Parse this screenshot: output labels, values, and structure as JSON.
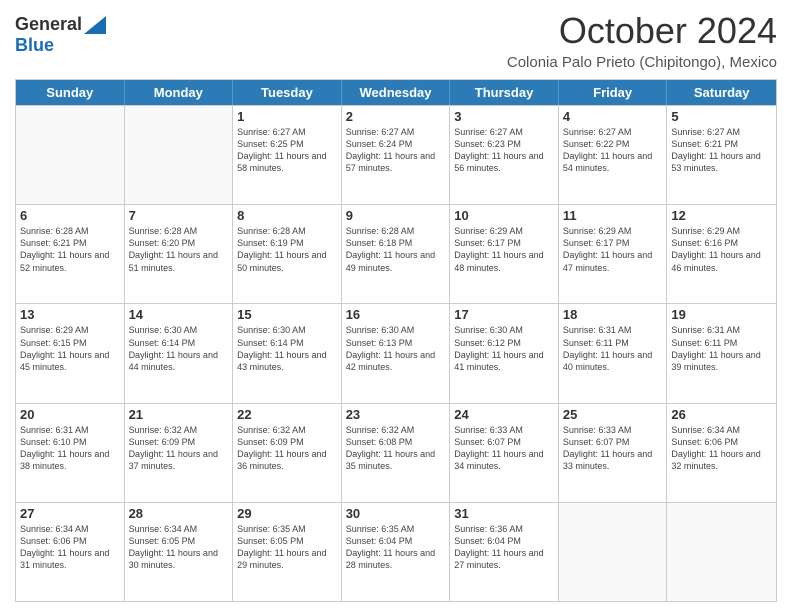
{
  "logo": {
    "general": "General",
    "blue": "Blue"
  },
  "title": {
    "month": "October 2024",
    "location": "Colonia Palo Prieto (Chipitongo), Mexico"
  },
  "header": {
    "days": [
      "Sunday",
      "Monday",
      "Tuesday",
      "Wednesday",
      "Thursday",
      "Friday",
      "Saturday"
    ]
  },
  "weeks": [
    [
      {
        "day": "",
        "empty": true
      },
      {
        "day": "",
        "empty": true
      },
      {
        "day": "1",
        "sunrise": "6:27 AM",
        "sunset": "6:25 PM",
        "daylight": "11 hours and 58 minutes."
      },
      {
        "day": "2",
        "sunrise": "6:27 AM",
        "sunset": "6:24 PM",
        "daylight": "11 hours and 57 minutes."
      },
      {
        "day": "3",
        "sunrise": "6:27 AM",
        "sunset": "6:23 PM",
        "daylight": "11 hours and 56 minutes."
      },
      {
        "day": "4",
        "sunrise": "6:27 AM",
        "sunset": "6:22 PM",
        "daylight": "11 hours and 54 minutes."
      },
      {
        "day": "5",
        "sunrise": "6:27 AM",
        "sunset": "6:21 PM",
        "daylight": "11 hours and 53 minutes."
      }
    ],
    [
      {
        "day": "6",
        "sunrise": "6:28 AM",
        "sunset": "6:21 PM",
        "daylight": "11 hours and 52 minutes."
      },
      {
        "day": "7",
        "sunrise": "6:28 AM",
        "sunset": "6:20 PM",
        "daylight": "11 hours and 51 minutes."
      },
      {
        "day": "8",
        "sunrise": "6:28 AM",
        "sunset": "6:19 PM",
        "daylight": "11 hours and 50 minutes."
      },
      {
        "day": "9",
        "sunrise": "6:28 AM",
        "sunset": "6:18 PM",
        "daylight": "11 hours and 49 minutes."
      },
      {
        "day": "10",
        "sunrise": "6:29 AM",
        "sunset": "6:17 PM",
        "daylight": "11 hours and 48 minutes."
      },
      {
        "day": "11",
        "sunrise": "6:29 AM",
        "sunset": "6:17 PM",
        "daylight": "11 hours and 47 minutes."
      },
      {
        "day": "12",
        "sunrise": "6:29 AM",
        "sunset": "6:16 PM",
        "daylight": "11 hours and 46 minutes."
      }
    ],
    [
      {
        "day": "13",
        "sunrise": "6:29 AM",
        "sunset": "6:15 PM",
        "daylight": "11 hours and 45 minutes."
      },
      {
        "day": "14",
        "sunrise": "6:30 AM",
        "sunset": "6:14 PM",
        "daylight": "11 hours and 44 minutes."
      },
      {
        "day": "15",
        "sunrise": "6:30 AM",
        "sunset": "6:14 PM",
        "daylight": "11 hours and 43 minutes."
      },
      {
        "day": "16",
        "sunrise": "6:30 AM",
        "sunset": "6:13 PM",
        "daylight": "11 hours and 42 minutes."
      },
      {
        "day": "17",
        "sunrise": "6:30 AM",
        "sunset": "6:12 PM",
        "daylight": "11 hours and 41 minutes."
      },
      {
        "day": "18",
        "sunrise": "6:31 AM",
        "sunset": "6:11 PM",
        "daylight": "11 hours and 40 minutes."
      },
      {
        "day": "19",
        "sunrise": "6:31 AM",
        "sunset": "6:11 PM",
        "daylight": "11 hours and 39 minutes."
      }
    ],
    [
      {
        "day": "20",
        "sunrise": "6:31 AM",
        "sunset": "6:10 PM",
        "daylight": "11 hours and 38 minutes."
      },
      {
        "day": "21",
        "sunrise": "6:32 AM",
        "sunset": "6:09 PM",
        "daylight": "11 hours and 37 minutes."
      },
      {
        "day": "22",
        "sunrise": "6:32 AM",
        "sunset": "6:09 PM",
        "daylight": "11 hours and 36 minutes."
      },
      {
        "day": "23",
        "sunrise": "6:32 AM",
        "sunset": "6:08 PM",
        "daylight": "11 hours and 35 minutes."
      },
      {
        "day": "24",
        "sunrise": "6:33 AM",
        "sunset": "6:07 PM",
        "daylight": "11 hours and 34 minutes."
      },
      {
        "day": "25",
        "sunrise": "6:33 AM",
        "sunset": "6:07 PM",
        "daylight": "11 hours and 33 minutes."
      },
      {
        "day": "26",
        "sunrise": "6:34 AM",
        "sunset": "6:06 PM",
        "daylight": "11 hours and 32 minutes."
      }
    ],
    [
      {
        "day": "27",
        "sunrise": "6:34 AM",
        "sunset": "6:06 PM",
        "daylight": "11 hours and 31 minutes."
      },
      {
        "day": "28",
        "sunrise": "6:34 AM",
        "sunset": "6:05 PM",
        "daylight": "11 hours and 30 minutes."
      },
      {
        "day": "29",
        "sunrise": "6:35 AM",
        "sunset": "6:05 PM",
        "daylight": "11 hours and 29 minutes."
      },
      {
        "day": "30",
        "sunrise": "6:35 AM",
        "sunset": "6:04 PM",
        "daylight": "11 hours and 28 minutes."
      },
      {
        "day": "31",
        "sunrise": "6:36 AM",
        "sunset": "6:04 PM",
        "daylight": "11 hours and 27 minutes."
      },
      {
        "day": "",
        "empty": true
      },
      {
        "day": "",
        "empty": true
      }
    ]
  ]
}
